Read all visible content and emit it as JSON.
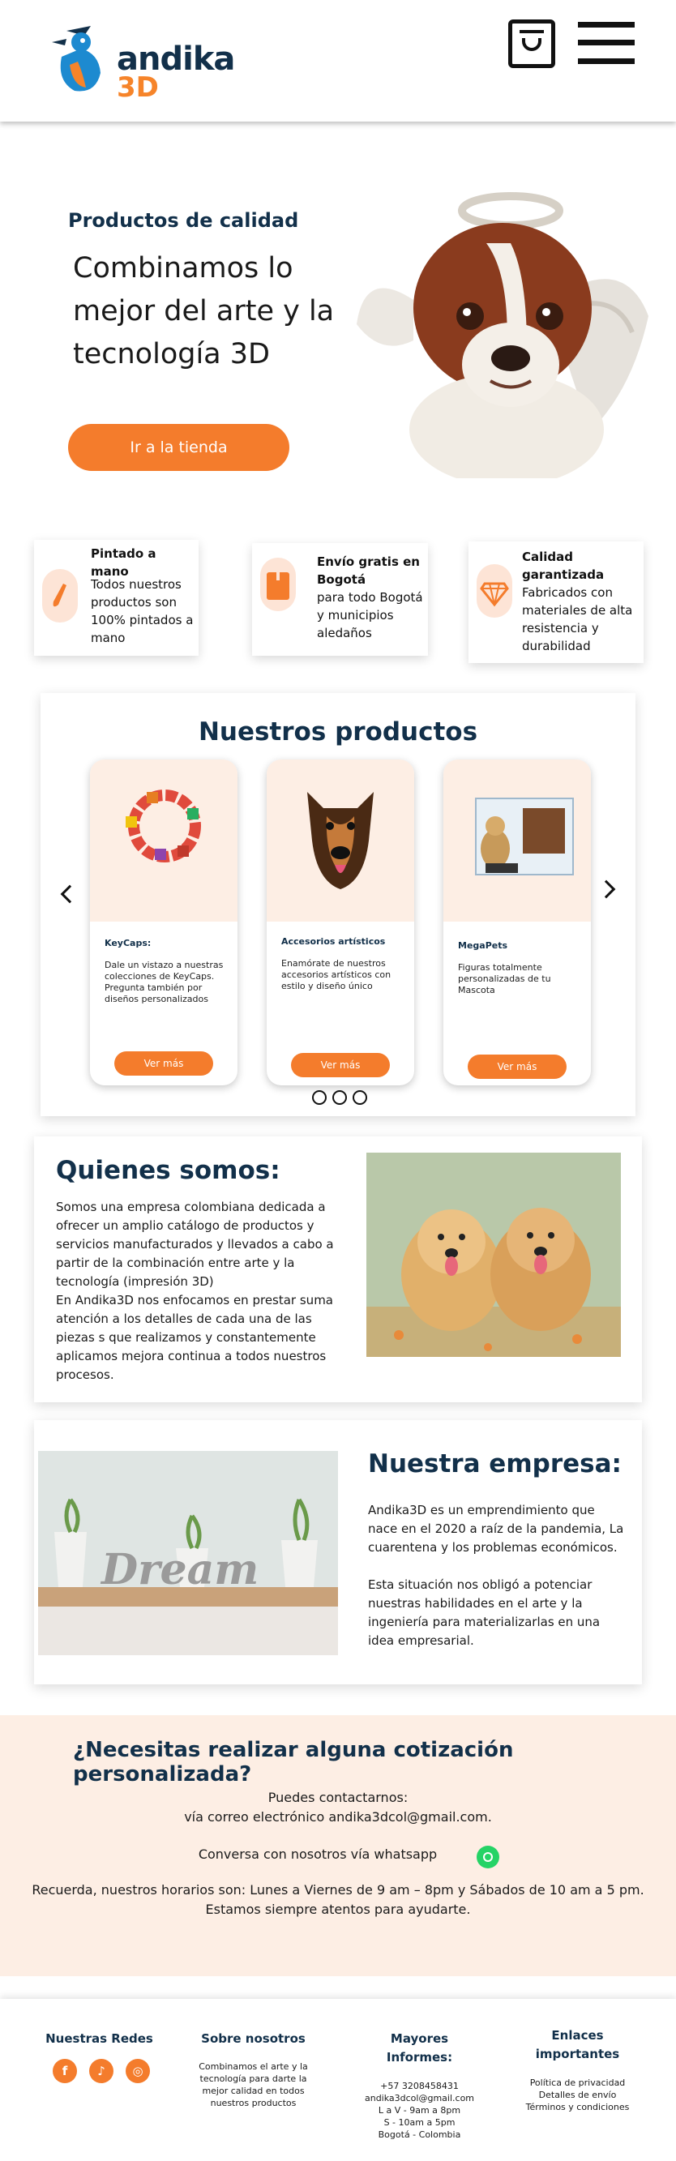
{
  "header": {
    "logo_word": "andika",
    "logo_3d": "3D"
  },
  "hero": {
    "eyebrow": "Productos de calidad",
    "title": "Combinamos lo mejor del arte y la tecnología 3D",
    "button": "Ir a la tienda"
  },
  "features": [
    {
      "title": "Pintado a mano",
      "text": "Todos nuestros productos son 100% pintados a mano",
      "icon": "brush-icon"
    },
    {
      "title": "Envío gratis en Bogotá",
      "text": "para todo Bogotá y municipios aledaños",
      "icon": "box-icon"
    },
    {
      "title": "Calidad garantizada",
      "text": "Fabricados con materiales de alta resistencia y durabilidad",
      "icon": "diamond-icon"
    }
  ],
  "products": {
    "title": "Nuestros productos",
    "items": [
      {
        "name": "KeyCaps:",
        "desc": "Dale un vistazo a nuestras colecciones de KeyCaps. Pregunta también por diseños personalizados",
        "button": "Ver más"
      },
      {
        "name": "Accesorios artísticos",
        "desc": "Enamórate de nuestros accesorios artísticos con estilo y diseño único",
        "button": "Ver más"
      },
      {
        "name": "MegaPets",
        "desc": "Figuras totalmente personalizadas de tu Mascota",
        "button": "Ver más"
      }
    ]
  },
  "about": {
    "title": "Quienes somos:",
    "text": "Somos una empresa colombiana dedicada a ofrecer un amplio catálogo de productos y servicios manufacturados y llevados a cabo a partir de la combinación entre arte y la tecnología (impresión 3D)\nEn Andika3D nos enfocamos en prestar suma atención a los detalles de cada una de las piezas s que realizamos y constantemente aplicamos mejora continua a todos nuestros procesos."
  },
  "company": {
    "title": "Nuestra empresa:",
    "p1": "Andika3D es un emprendimiento que nace en el 2020 a raíz de la pandemia, La cuarentena y los problemas económicos.",
    "p2": "Esta situación nos obligó a potenciar nuestras habilidades en el arte y la ingeniería para materializarlas en una idea empresarial.",
    "image_word": "Dream"
  },
  "quote": {
    "title": "¿Necesitas realizar alguna cotización personalizada?",
    "line1": "Puedes contactarnos:",
    "line2": "vía correo electrónico andika3dcol@gmail.com.",
    "line3": "Conversa con nosotros vía whatsapp",
    "line4": "Recuerda, nuestros horarios son: Lunes a Viernes de 9 am – 8pm y Sábados de 10 am a 5 pm.",
    "line5": "Estamos siempre atentos para ayudarte."
  },
  "footer": {
    "redes_title": "Nuestras Redes",
    "sobre_title": "Sobre nosotros",
    "sobre_text": "Combinamos el arte y la tecnología para darte la mejor calidad en todos nuestros productos",
    "informes_title": "Mayores Informes:",
    "informes_lines": [
      "+57 3208458431",
      "andika3dcol@gmail.com",
      "L a V - 9am a 8pm",
      "S - 10am a 5pm",
      "Bogotá - Colombia"
    ],
    "enlaces_title": "Enlaces importantes",
    "enlaces_lines": [
      "Política de privacidad",
      "Detalles de envío",
      "Términos y condiciones"
    ]
  },
  "colors": {
    "brand_dark": "#12304a",
    "accent": "#f47c2c",
    "peach": "#fdeee4"
  }
}
